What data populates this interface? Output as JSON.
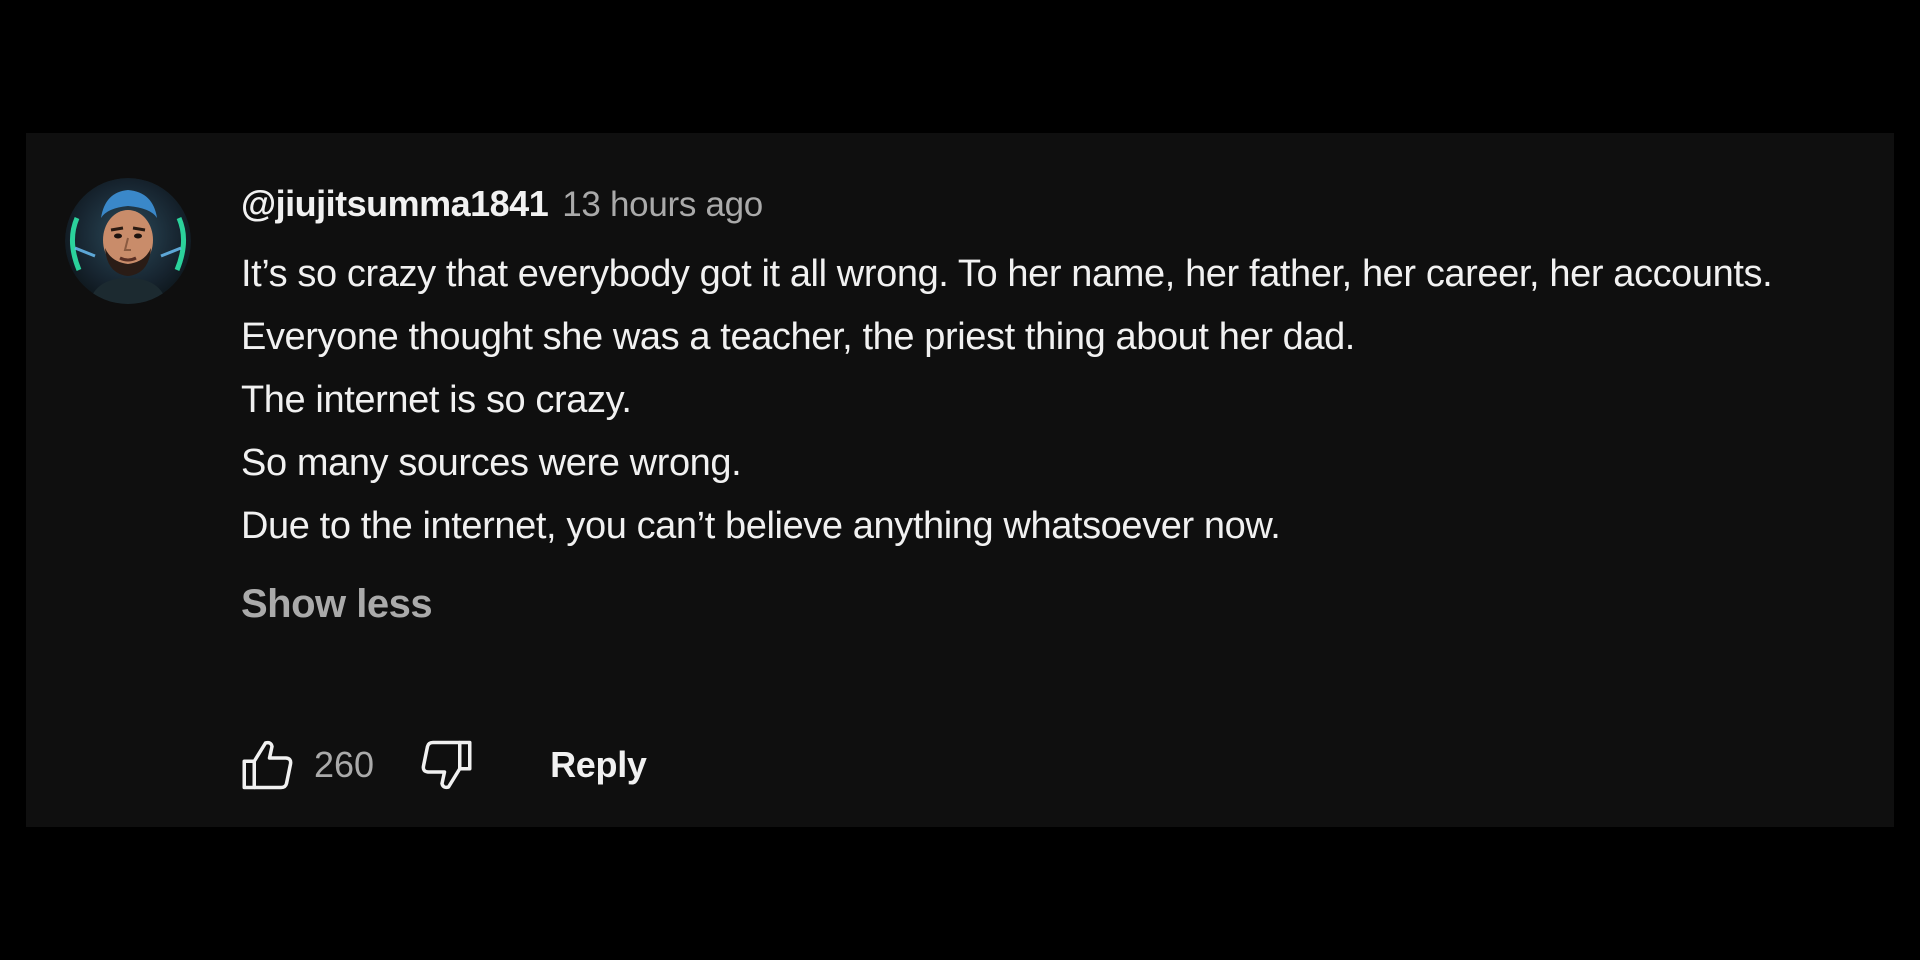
{
  "comment": {
    "username": "@jiujitsumma1841",
    "timestamp": "13 hours ago",
    "avatar_icon": "user-avatar-icon",
    "lines": [
      "It’s so crazy that everybody got it all wrong. To her name, her father, her career, her accounts.",
      "Everyone thought she was a teacher, the priest thing about her dad.",
      "The internet is so crazy.",
      "So many sources were wrong.",
      "Due to the internet, you can’t believe anything whatsoever now."
    ],
    "show_less_label": "Show less",
    "like_count": "260",
    "reply_label": "Reply",
    "like_icon": "thumbs-up-icon",
    "dislike_icon": "thumbs-down-icon"
  },
  "colors": {
    "page_background": "#000000",
    "panel_background": "#0f0f0f",
    "primary_text": "#f1f1f1",
    "secondary_text": "#aaaaaa",
    "avatar_accent": "#2ee6a8"
  }
}
